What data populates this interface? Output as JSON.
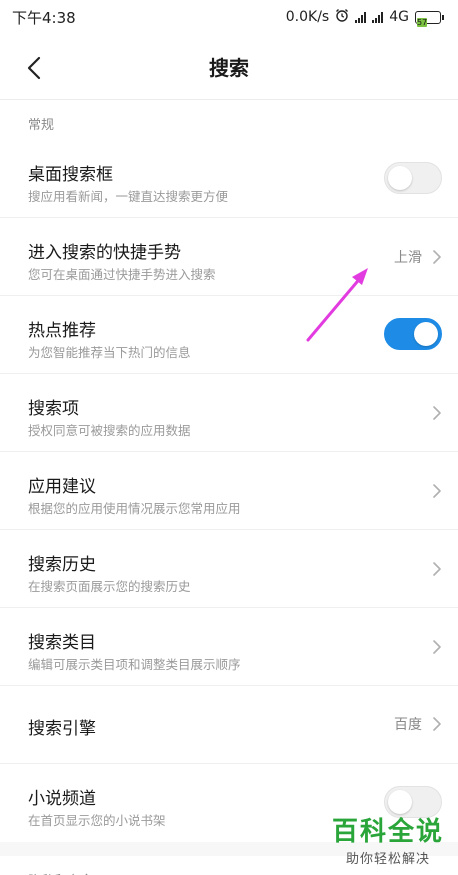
{
  "status_bar": {
    "time": "下午4:38",
    "speed": "0.0K/s",
    "network": "4G",
    "battery": "57"
  },
  "header": {
    "title": "搜索"
  },
  "sections": {
    "general": "常规",
    "privacy": "隐私和安全"
  },
  "rows": [
    {
      "title": "桌面搜索框",
      "desc": "搜应用看新闻，一键直达搜索更方便",
      "toggle": false
    },
    {
      "title": "进入搜索的快捷手势",
      "desc": "您可在桌面通过快捷手势进入搜索",
      "value": "上滑"
    },
    {
      "title": "热点推荐",
      "desc": "为您智能推荐当下热门的信息",
      "toggle": true
    },
    {
      "title": "搜索项",
      "desc": "授权同意可被搜索的应用数据"
    },
    {
      "title": "应用建议",
      "desc": "根据您的应用使用情况展示您常用应用"
    },
    {
      "title": "搜索历史",
      "desc": "在搜索页面展示您的搜索历史"
    },
    {
      "title": "搜索类目",
      "desc": "编辑可展示类目项和调整类目展示顺序"
    },
    {
      "title": "搜索引擎",
      "value": "百度"
    },
    {
      "title": "小说频道",
      "desc": "在首页显示您的小说书架",
      "toggle": false
    }
  ],
  "colors": {
    "toggle_on": "#1e8ce6",
    "annotation_arrow": "#e23ce0",
    "watermark": "#2aa53a"
  },
  "watermark": {
    "title": "百科全说",
    "subtitle": "助你轻松解决"
  }
}
